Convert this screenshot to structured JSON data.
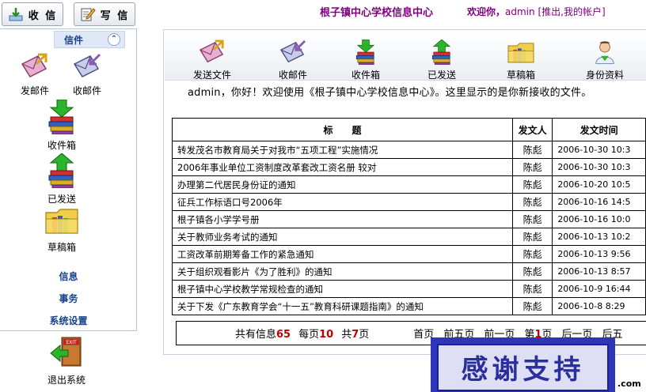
{
  "top": {
    "receive_label": "收 信",
    "write_label": "写 信"
  },
  "header": {
    "site_title": "根子镇中心学校信息中心",
    "welcome": "欢迎你，",
    "user": "admin",
    "links": "[推出,我的帐户]"
  },
  "sidebar": {
    "section_label": "信件",
    "items": [
      {
        "label": "发邮件",
        "icon": "send-mail-icon"
      },
      {
        "label": "收邮件",
        "icon": "receive-mail-icon"
      },
      {
        "label": "收件箱",
        "icon": "inbox-icon"
      },
      {
        "label": "已发送",
        "icon": "sent-icon"
      },
      {
        "label": "草稿箱",
        "icon": "drafts-icon"
      }
    ],
    "links": [
      "信息",
      "事务",
      "系统设置"
    ],
    "logout_label": "退出系统"
  },
  "toolbar": {
    "items": [
      {
        "label": "发送文件",
        "icon": "send-file-icon"
      },
      {
        "label": "收邮件",
        "icon": "receive-mail-icon"
      },
      {
        "label": "收件箱",
        "icon": "inbox-icon"
      },
      {
        "label": "已发送",
        "icon": "sent-icon"
      },
      {
        "label": "草稿箱",
        "icon": "drafts-icon"
      },
      {
        "label": "身份资料",
        "icon": "profile-icon"
      }
    ]
  },
  "notice": "admin，你好！欢迎使用《根子镇中心学校信息中心》。这里显示的是你新接收的文件。",
  "table": {
    "headers": [
      "标　　题",
      "发文人",
      "发文时间"
    ],
    "rows": [
      {
        "title": "转发茂名市教育局关于对我市“五项工程”实施情况",
        "sender": "陈彪",
        "time": "2006-10-30 10:3"
      },
      {
        "title": "2006年事业单位工资制度改革套改工资名册 较对",
        "sender": "陈彪",
        "time": "2006-10-30 10:3"
      },
      {
        "title": "办理第二代居民身份证的通知",
        "sender": "陈彪",
        "time": "2006-10-20 10:5"
      },
      {
        "title": "征兵工作标语口号2006年",
        "sender": "陈彪",
        "time": "2006-10-16 14:5"
      },
      {
        "title": "根子镇各小学学号册",
        "sender": "陈彪",
        "time": "2006-10-16 10:0"
      },
      {
        "title": "关于教师业务考试的通知",
        "sender": "陈彪",
        "time": "2006-10-13 10:2"
      },
      {
        "title": "工资改革前期筹备工作的紧急通知",
        "sender": "陈彪",
        "time": "2006-10-13 9:56"
      },
      {
        "title": "关于组织观看影片《为了胜利》的通知",
        "sender": "陈彪",
        "time": "2006-10-13 8:57"
      },
      {
        "title": "根子镇中心学校教学常规检查的通知",
        "sender": "陈彪",
        "time": "2006-10-9 16:44"
      },
      {
        "title": "关于下发《广东教育学会“十一五”教育科研课题指南》的通知",
        "sender": "陈彪",
        "time": "2006-10-8 8:29"
      }
    ]
  },
  "pager": {
    "total_prefix": "共有信息",
    "total": "65",
    "per_prefix": "每页",
    "per": "10",
    "pages_prefix": "共",
    "pages": "7",
    "pages_suffix": "页",
    "first": "首页",
    "prev5": "前五页",
    "prev": "前一页",
    "current_prefix": "第",
    "current": "1",
    "current_suffix": "页",
    "next": "后一页",
    "next5": "后五"
  },
  "watermark": {
    "text": "感谢支持",
    "domain": ".com"
  },
  "colors": {
    "accent_purple": "#800080",
    "sidebar_link": "#15428b",
    "pager_number": "#c00000",
    "watermark_blue": "#2f35b8"
  }
}
